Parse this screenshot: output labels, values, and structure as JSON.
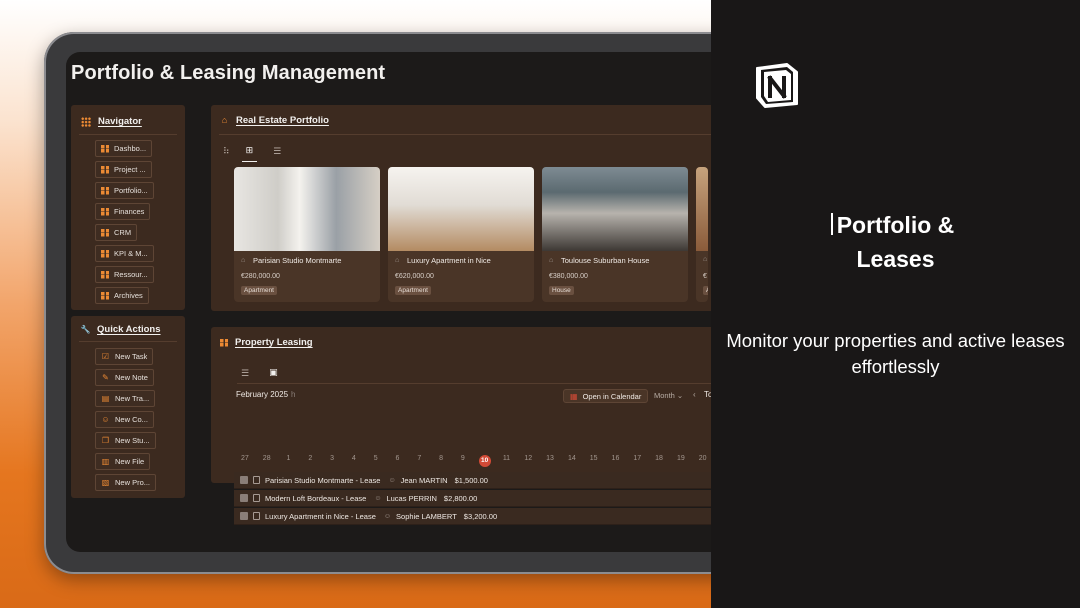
{
  "page": {
    "title": "Portfolio & Leasing Management"
  },
  "navigator": {
    "title": "Navigator",
    "items": [
      "Dashbo...",
      "Project ...",
      "Portfolio...",
      "Finances",
      "CRM",
      "KPI & M...",
      "Ressour...",
      "Archives"
    ]
  },
  "quick_actions": {
    "title": "Quick Actions",
    "items": [
      {
        "label": "New Task",
        "icon": "check-icon"
      },
      {
        "label": "New Note",
        "icon": "pencil-icon"
      },
      {
        "label": "New Tra...",
        "icon": "money-icon"
      },
      {
        "label": "New Co...",
        "icon": "person-icon"
      },
      {
        "label": "New Stu...",
        "icon": "copy-icon"
      },
      {
        "label": "New File",
        "icon": "file-icon"
      },
      {
        "label": "New Pro...",
        "icon": "project-icon"
      }
    ]
  },
  "portfolio": {
    "title": "Real Estate Portfolio",
    "cards": [
      {
        "name": "Parisian Studio Montmarte",
        "price": "€280,000.00",
        "tag": "Apartment"
      },
      {
        "name": "Luxury Apartment in Nice",
        "price": "€620,000.00",
        "tag": "Apartment"
      },
      {
        "name": "Toulouse Suburban House",
        "price": "€380,000.00",
        "tag": "House"
      },
      {
        "name": "",
        "price": "€",
        "tag": "A"
      }
    ]
  },
  "leasing": {
    "title": "Property Leasing",
    "month": "February 2025",
    "month_suffix": "h",
    "open_calendar": "Open in Calendar",
    "view_select": "Month",
    "today_label": "To",
    "dates": [
      "27",
      "28",
      "1",
      "2",
      "3",
      "4",
      "5",
      "6",
      "7",
      "8",
      "9",
      "10",
      "11",
      "12",
      "13",
      "14",
      "15",
      "16",
      "17",
      "18",
      "19",
      "20"
    ],
    "today": "10",
    "leases": [
      {
        "name": "Parisian Studio Montmarte - Lease",
        "tenant": "Jean MARTIN",
        "amount": "$1,500.00"
      },
      {
        "name": "Modern Loft Bordeaux - Lease",
        "tenant": "Lucas PERRIN",
        "amount": "$2,800.00"
      },
      {
        "name": "Luxury Apartment in Nice - Lease",
        "tenant": "Sophie LAMBERT",
        "amount": "$3,200.00"
      }
    ]
  },
  "promo": {
    "title_line1": "Portfolio &",
    "title_line2": "Leases",
    "subtitle": "Monitor your properties and active leases effortlessly",
    "logo_icon": "notion-logo-icon"
  },
  "colors": {
    "accent": "#ec8a34",
    "panel": "#3c2a1f",
    "today": "#d24a36"
  }
}
